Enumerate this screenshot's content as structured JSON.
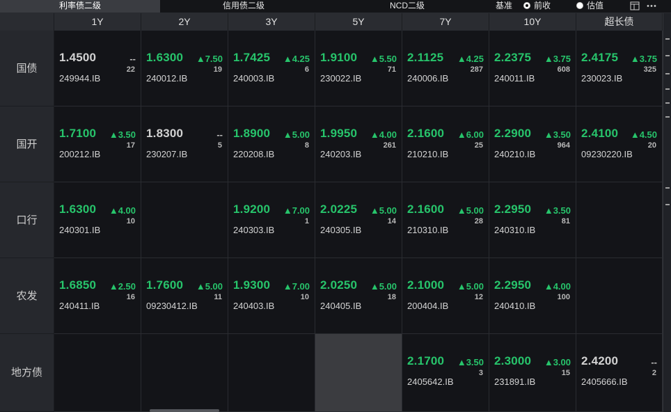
{
  "tabs": [
    {
      "label": "利率债二级",
      "active": true
    },
    {
      "label": "信用债二级",
      "active": false
    },
    {
      "label": "NCD二级",
      "active": false
    }
  ],
  "basis": {
    "label": "基准",
    "options": [
      {
        "label": "前收",
        "selected": true
      },
      {
        "label": "估值",
        "selected": false
      }
    ]
  },
  "toolbar_icons": [
    "layout-icon",
    "more-icon"
  ],
  "columns": [
    "1Y",
    "2Y",
    "3Y",
    "5Y",
    "7Y",
    "10Y",
    "超长债"
  ],
  "rows": [
    {
      "label": "国债",
      "cells": [
        {
          "rate": "1.4500",
          "change": "--",
          "count": "22",
          "code": "249944.IB",
          "up": false
        },
        {
          "rate": "1.6300",
          "change": "▲7.50",
          "count": "19",
          "code": "240012.IB",
          "up": true
        },
        {
          "rate": "1.7425",
          "change": "▲4.25",
          "count": "6",
          "code": "240003.IB",
          "up": true
        },
        {
          "rate": "1.9100",
          "change": "▲5.50",
          "count": "71",
          "code": "230022.IB",
          "up": true
        },
        {
          "rate": "2.1125",
          "change": "▲4.25",
          "count": "287",
          "code": "240006.IB",
          "up": true
        },
        {
          "rate": "2.2375",
          "change": "▲3.75",
          "count": "608",
          "code": "240011.IB",
          "up": true
        },
        {
          "rate": "2.4175",
          "change": "▲3.75",
          "count": "325",
          "code": "230023.IB",
          "up": true
        }
      ]
    },
    {
      "label": "国开",
      "cells": [
        {
          "rate": "1.7100",
          "change": "▲3.50",
          "count": "17",
          "code": "200212.IB",
          "up": true
        },
        {
          "rate": "1.8300",
          "change": "--",
          "count": "5",
          "code": "230207.IB",
          "up": false
        },
        {
          "rate": "1.8900",
          "change": "▲5.00",
          "count": "8",
          "code": "220208.IB",
          "up": true
        },
        {
          "rate": "1.9950",
          "change": "▲4.00",
          "count": "261",
          "code": "240203.IB",
          "up": true
        },
        {
          "rate": "2.1600",
          "change": "▲6.00",
          "count": "25",
          "code": "210210.IB",
          "up": true
        },
        {
          "rate": "2.2900",
          "change": "▲3.50",
          "count": "964",
          "code": "240210.IB",
          "up": true
        },
        {
          "rate": "2.4100",
          "change": "▲4.50",
          "count": "20",
          "code": "09230220.IB",
          "up": true
        }
      ]
    },
    {
      "label": "口行",
      "cells": [
        {
          "rate": "1.6300",
          "change": "▲4.00",
          "count": "10",
          "code": "240301.IB",
          "up": true
        },
        null,
        {
          "rate": "1.9200",
          "change": "▲7.00",
          "count": "1",
          "code": "240303.IB",
          "up": true
        },
        {
          "rate": "2.0225",
          "change": "▲5.00",
          "count": "14",
          "code": "240305.IB",
          "up": true
        },
        {
          "rate": "2.1600",
          "change": "▲5.00",
          "count": "28",
          "code": "210310.IB",
          "up": true
        },
        {
          "rate": "2.2950",
          "change": "▲3.50",
          "count": "81",
          "code": "240310.IB",
          "up": true
        },
        null
      ]
    },
    {
      "label": "农发",
      "cells": [
        {
          "rate": "1.6850",
          "change": "▲2.50",
          "count": "16",
          "code": "240411.IB",
          "up": true
        },
        {
          "rate": "1.7600",
          "change": "▲5.00",
          "count": "11",
          "code": "09230412.IB",
          "up": true
        },
        {
          "rate": "1.9300",
          "change": "▲7.00",
          "count": "10",
          "code": "240403.IB",
          "up": true
        },
        {
          "rate": "2.0250",
          "change": "▲5.00",
          "count": "18",
          "code": "240405.IB",
          "up": true
        },
        {
          "rate": "2.1000",
          "change": "▲5.00",
          "count": "12",
          "code": "200404.IB",
          "up": true
        },
        {
          "rate": "2.2950",
          "change": "▲4.00",
          "count": "100",
          "code": "240410.IB",
          "up": true
        },
        null
      ]
    },
    {
      "label": "地方债",
      "cells": [
        null,
        null,
        null,
        "disabled",
        {
          "rate": "2.1700",
          "change": "▲3.50",
          "count": "3",
          "code": "2405642.IB",
          "up": true
        },
        {
          "rate": "2.3000",
          "change": "▲3.00",
          "count": "15",
          "code": "231891.IB",
          "up": true
        },
        {
          "rate": "2.4200",
          "change": "--",
          "count": "2",
          "code": "2405666.IB",
          "up": false
        }
      ]
    }
  ],
  "colors": {
    "up": "#27c46b",
    "neutral": "#d2d2d2",
    "background": "#131418",
    "header": "#2a2c31"
  }
}
